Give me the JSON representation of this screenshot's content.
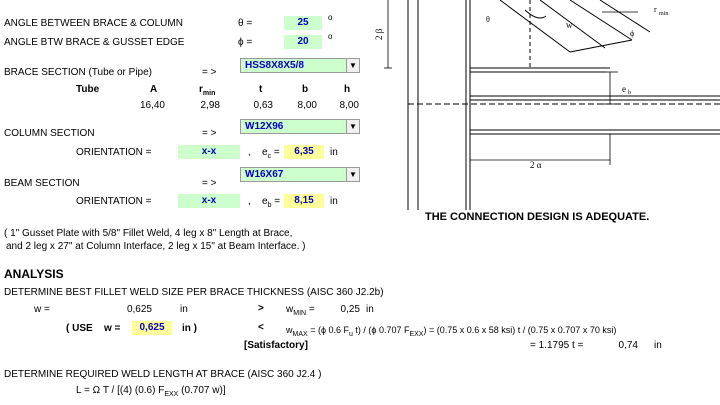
{
  "inputs": {
    "theta_label": "ANGLE BETWEEN BRACE & COLUMN",
    "theta_sym": "θ =",
    "theta_value": "25",
    "phi_label": "ANGLE BTW BRACE & GUSSET EDGE",
    "phi_sym": "ϕ =",
    "phi_value": "20",
    "deg": "o",
    "brace_label": "BRACE SECTION (Tube or Pipe)",
    "arrow": "= >",
    "brace_value": "HSS8X8X5/8",
    "tube_label": "Tube",
    "props_headers": [
      "A",
      "r",
      "min",
      "t",
      "b",
      "h"
    ],
    "props_values": [
      "16,40",
      "2,98",
      "0,63",
      "8,00",
      "8,00"
    ],
    "column_label": "COLUMN SECTION",
    "column_value": "W12X96",
    "orientation_label": "ORIENTATION =",
    "column_orient": "x-x",
    "comma": ",",
    "ec_sym": "e",
    "ec_sub": "c",
    "eq": "=",
    "ec_value": "6,35",
    "unit_in": "in",
    "beam_label": "BEAM SECTION",
    "beam_value": "W16X67",
    "beam_orient": "x-x",
    "eb_sub": "b",
    "eb_value": "8,15"
  },
  "result": {
    "adequate": "THE CONNECTION DESIGN IS ADEQUATE."
  },
  "summary": {
    "line1": "( 1\" Gusset Plate with 5/8\" Fillet Weld, 4 leg x 8\" Length at Brace,",
    "line2": "and 2 leg x 27\" at Column Interface, 2 leg x 15\" at Beam Interface. )"
  },
  "analysis": {
    "title": "ANALYSIS",
    "weld_heading": "DETERMINE BEST FILLET WELD SIZE PER BRACE THICKNESS (AISC 360 J2.2b)",
    "w_label": "w =",
    "w_value": "0,625",
    "in": "in",
    "gt": ">",
    "wmin_label": "w",
    "wmin_sub": "MIN",
    "wmin_eq": "=",
    "wmin_value": "0,25",
    "use_open": "( USE",
    "use_w": "w =",
    "use_value": "0,625",
    "use_close": "in )",
    "lt": "<",
    "wmax_label": "w",
    "wmax_sub": "MAX",
    "wmax_formula": "= (ϕ 0.6 F",
    "wmax_formula2": "u",
    "wmax_formula3": " t) / (ϕ 0.707 F",
    "wmax_formula4": "EXX",
    "wmax_formula5": ") = (0.75 x 0.6 x 58 ksi) t / (0.75 x 0.707 x 70 ksi)",
    "satisfactory": "[Satisfactory]",
    "wmax_result": "= 1.1795 t =",
    "wmax_value": "0,74",
    "length_heading": "DETERMINE REQUIRED WELD LENGTH AT BRACE (AISC 360 J2.4 )",
    "length_formula": "L = Ω T / [(4) (0.6) F",
    "length_formula_sub": "EXX",
    "length_formula_end": " (0.707 w)]"
  },
  "diagram": {
    "two_beta": "2 β",
    "two_alpha": "2 α",
    "e_b": "e",
    "e_b_sub": "b",
    "w": "w",
    "theta": "θ",
    "phi": "ϕ",
    "r_min": "r",
    "r_min_sub": "min"
  },
  "colors": {
    "input_green": "#ccffcc",
    "output_yellow": "#ffff99",
    "value_blue": "#0000cc"
  }
}
